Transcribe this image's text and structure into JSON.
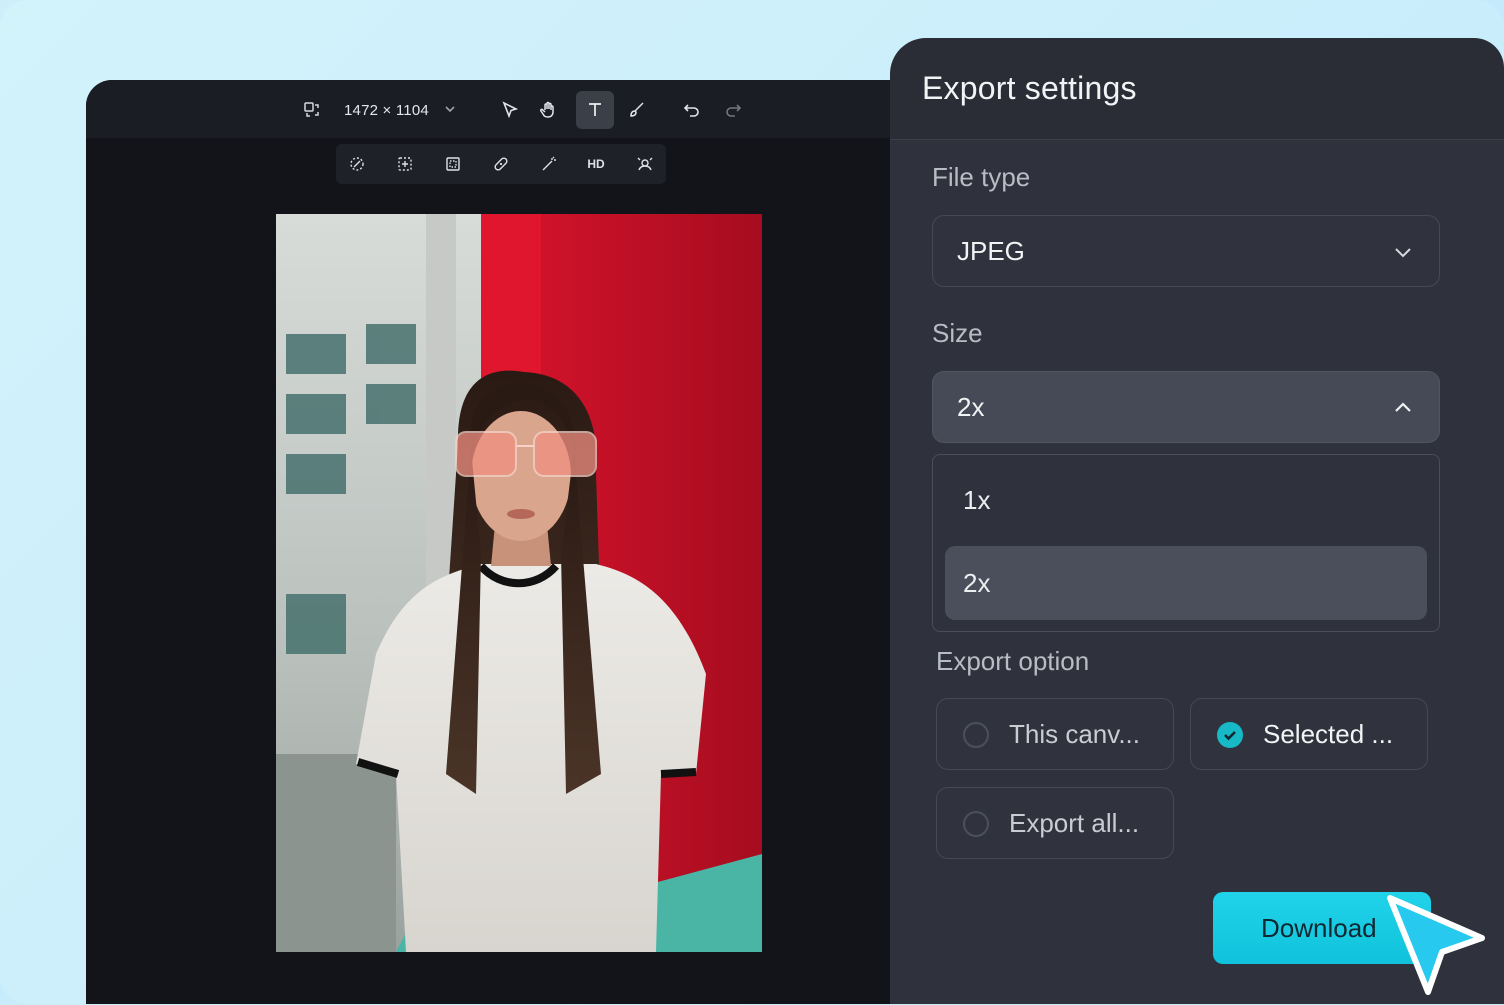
{
  "editor": {
    "canvas_size": "1472 × 1104",
    "subtools": {
      "hd_label": "HD"
    }
  },
  "export_panel": {
    "title": "Export settings",
    "file_type": {
      "label": "File type",
      "value": "JPEG"
    },
    "size": {
      "label": "Size",
      "value": "2x",
      "options": [
        "1x",
        "2x"
      ],
      "selected_option": "2x"
    },
    "export_option": {
      "label": "Export option",
      "options": [
        {
          "label": "This canv...",
          "selected": false
        },
        {
          "label": "Selected ...",
          "selected": true
        },
        {
          "label": "Export all...",
          "selected": false
        }
      ]
    },
    "download_label": "Download"
  },
  "colors": {
    "accent": "#10c2db",
    "panel": "#2f323c",
    "editor": "#12141a"
  }
}
